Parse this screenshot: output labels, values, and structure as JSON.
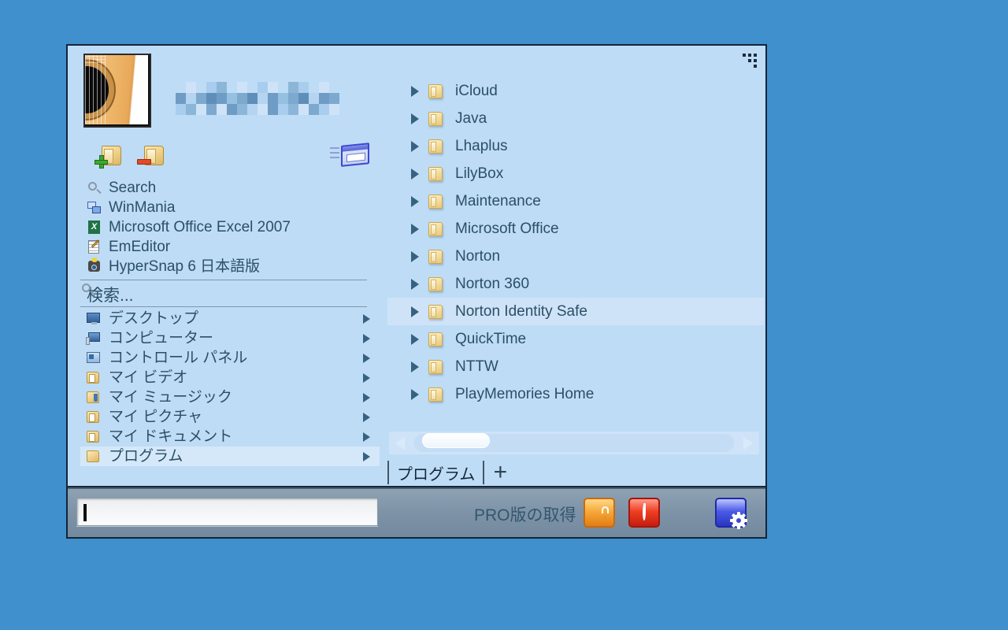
{
  "desktop": {
    "background_color": "#3f90cc"
  },
  "window": {
    "title": "",
    "resize_grip_icon": "resize-grip-icon",
    "border_color": "#13253a",
    "panel_color": "#bedcf5"
  },
  "user": {
    "avatar_icon": "guitar-avatar",
    "name_censored": "",
    "name_is_pixelated": true
  },
  "left_panel": {
    "toolbar": [
      {
        "name": "add-folder-button",
        "icon": "folder-add-icon",
        "label": ""
      },
      {
        "name": "remove-folder-button",
        "icon": "folder-remove-icon",
        "label": ""
      },
      {
        "name": "run-window-button",
        "icon": "window-run-icon",
        "label": ""
      }
    ],
    "shortcuts": [
      {
        "icon": "magnifier-icon",
        "label": "Search"
      },
      {
        "icon": "winmania-icon",
        "label": "WinMania"
      },
      {
        "icon": "excel-icon",
        "label": "Microsoft Office Excel 2007"
      },
      {
        "icon": "emeditor-icon",
        "label": "EmEditor"
      },
      {
        "icon": "hypersnap-icon",
        "label": "HyperSnap 6 日本語版"
      }
    ],
    "search": {
      "icon": "magnifier-icon",
      "label": "検索..."
    },
    "places": [
      {
        "icon": "desktop-icon",
        "label": "デスクトップ",
        "has_submenu": true,
        "selected": false
      },
      {
        "icon": "computer-icon",
        "label": "コンピューター",
        "has_submenu": true,
        "selected": false
      },
      {
        "icon": "control-panel-icon",
        "label": "コントロール パネル",
        "has_submenu": true,
        "selected": false
      },
      {
        "icon": "video-folder-icon",
        "label": "マイ ビデオ",
        "has_submenu": true,
        "selected": false
      },
      {
        "icon": "music-folder-icon",
        "label": "マイ ミュージック",
        "has_submenu": true,
        "selected": false
      },
      {
        "icon": "pictures-folder-icon",
        "label": "マイ ピクチャ",
        "has_submenu": true,
        "selected": false
      },
      {
        "icon": "documents-folder-icon",
        "label": "マイ ドキュメント",
        "has_submenu": true,
        "selected": false
      },
      {
        "icon": "programs-folder-icon",
        "label": "プログラム",
        "has_submenu": true,
        "selected": true
      }
    ]
  },
  "right_panel": {
    "folders": [
      {
        "icon": "folder-icon",
        "label": "iCloud",
        "hovered": false
      },
      {
        "icon": "folder-icon",
        "label": "Java",
        "hovered": false
      },
      {
        "icon": "folder-icon",
        "label": "Lhaplus",
        "hovered": false
      },
      {
        "icon": "folder-icon",
        "label": "LilyBox",
        "hovered": false
      },
      {
        "icon": "folder-icon",
        "label": "Maintenance",
        "hovered": false
      },
      {
        "icon": "folder-icon",
        "label": "Microsoft Office",
        "hovered": false
      },
      {
        "icon": "folder-icon",
        "label": "Norton",
        "hovered": false
      },
      {
        "icon": "folder-icon",
        "label": "Norton 360",
        "hovered": false
      },
      {
        "icon": "folder-icon",
        "label": "Norton Identity Safe",
        "hovered": true
      },
      {
        "icon": "folder-icon",
        "label": "QuickTime",
        "hovered": false
      },
      {
        "icon": "folder-icon",
        "label": "NTTW",
        "hovered": false
      },
      {
        "icon": "folder-icon",
        "label": "PlayMemories Home",
        "hovered": false
      }
    ],
    "scrollbar": {
      "left_arrow_icon": "scroll-left-arrow-icon",
      "right_arrow_icon": "scroll-right-arrow-icon",
      "thumb_position_percent": 10
    },
    "tabs": [
      {
        "label": "プログラム",
        "active": true
      }
    ],
    "add_tab_label": "+"
  },
  "bottom_bar": {
    "command_input": {
      "value": "",
      "placeholder": ""
    },
    "pro_label": "PRO版の取得",
    "buttons": [
      {
        "name": "lock-button",
        "icon": "lock-icon",
        "color": "#f5a93a"
      },
      {
        "name": "power-button",
        "icon": "power-icon",
        "color": "#ee3f22"
      },
      {
        "name": "settings-button",
        "icon": "gear-icon",
        "color": "#4b5ae6"
      }
    ]
  }
}
